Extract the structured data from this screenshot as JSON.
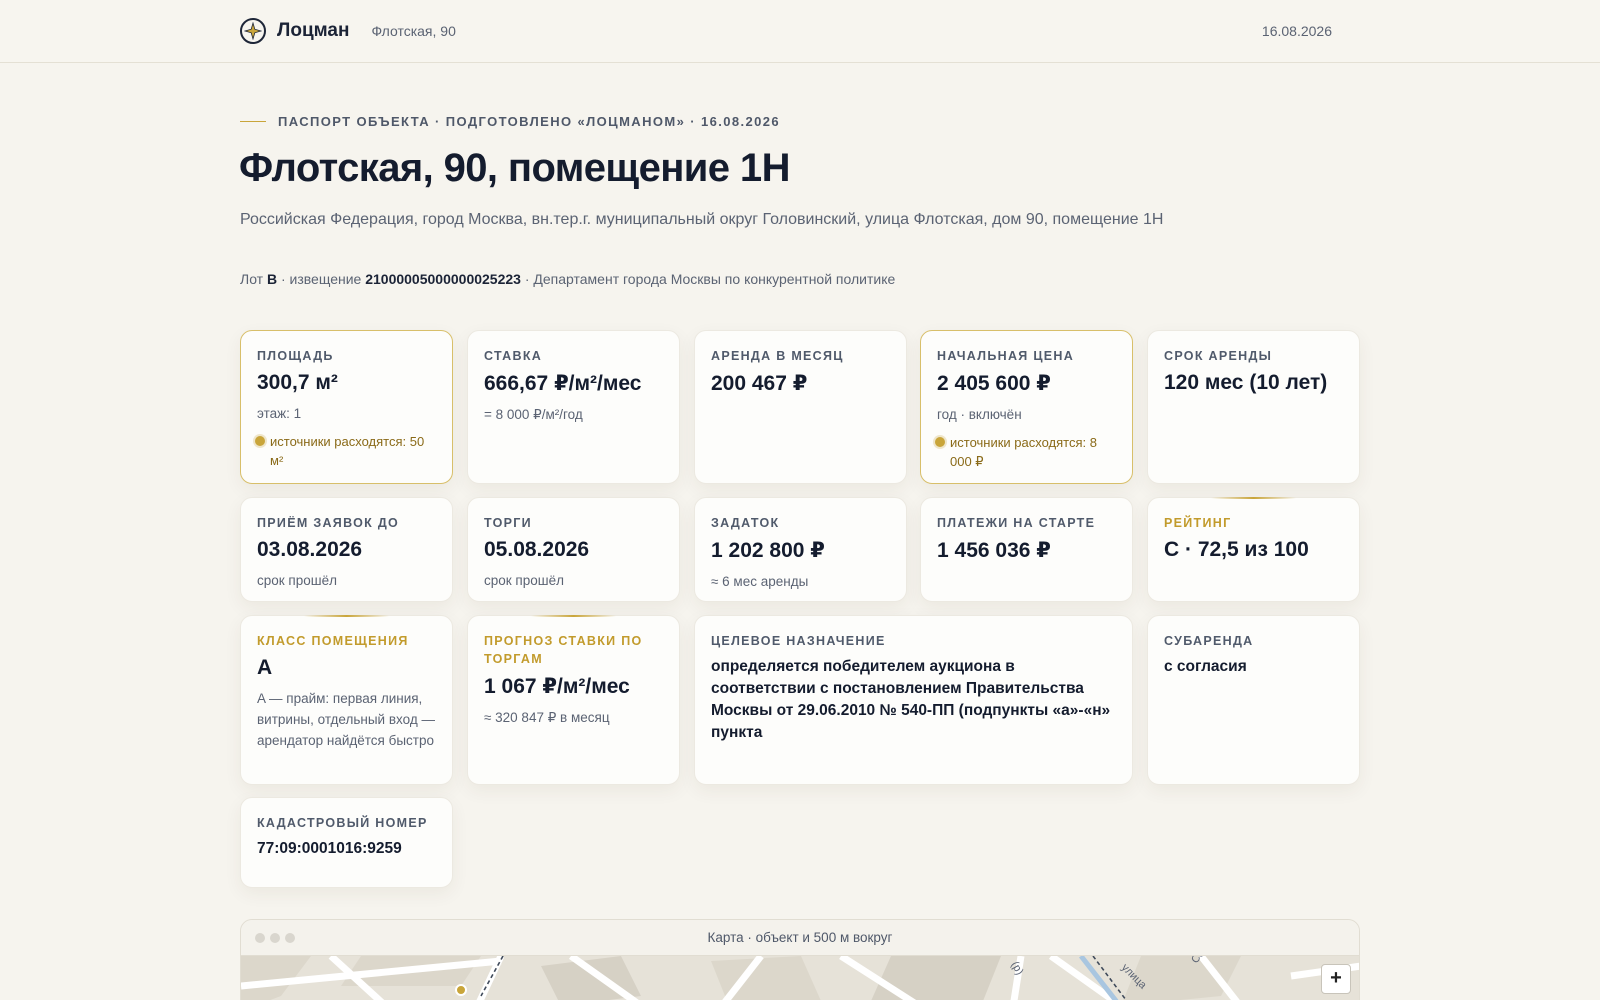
{
  "header": {
    "brand": "Лоцман",
    "address": "Флотская, 90",
    "date": "16.08.2026"
  },
  "passport": {
    "eyebrow": "ПАСПОРТ ОБЪЕКТА · ПОДГОТОВЛЕНО «ЛОЦМАНОМ» · 16.08.2026",
    "title": "Флотская, 90, помещение 1Н",
    "full_address": "Российская Федерация, город Москва, вн.тер.г. муниципальный округ Головинский, улица Флотская, дом 90, помещение 1Н",
    "lot_prefix": "Лот ",
    "lot": "В",
    "notice_prefix": " · извещение ",
    "notice": "21000005000000025223",
    "organizer": " · Департамент города Москвы по конкурентной политике"
  },
  "cards": {
    "area": {
      "label": "ПЛОЩАДЬ",
      "value": "300,7 м²",
      "sub": "этаж: 1",
      "warn": "источники расходятся: 50 м²"
    },
    "rate": {
      "label": "СТАВКА",
      "value": "666,67 ₽/м²/мес",
      "sub": "= 8 000 ₽/м²/год"
    },
    "monthly": {
      "label": "АРЕНДА В МЕСЯЦ",
      "value": "200 467 ₽"
    },
    "start_price": {
      "label": "НАЧАЛЬНАЯ ЦЕНА",
      "value": "2 405 600 ₽",
      "sub": "год · включён",
      "warn": "источники расходятся: 8 000 ₽"
    },
    "term": {
      "label": "СРОК АРЕНДЫ",
      "value": "120 мес (10 лет)"
    },
    "apps_until": {
      "label": "ПРИЁМ ЗАЯВОК ДО",
      "value": "03.08.2026",
      "sub": "срок прошёл"
    },
    "auction": {
      "label": "ТОРГИ",
      "value": "05.08.2026",
      "sub": "срок прошёл"
    },
    "deposit": {
      "label": "ЗАДАТОК",
      "value": "1 202 800 ₽",
      "sub": "≈ 6 мес аренды"
    },
    "start_payments": {
      "label": "ПЛАТЕЖИ НА СТАРТЕ",
      "value": "1 456 036 ₽"
    },
    "rating": {
      "label": "РЕЙТИНГ",
      "value": "C · 72,5 из 100"
    },
    "class": {
      "label": "КЛАСС ПОМЕЩЕНИЯ",
      "value": "A",
      "sub": "A — прайм: первая линия, витрины, отдельный вход — арендатор найдётся быстро"
    },
    "forecast": {
      "label": "ПРОГНОЗ СТАВКИ ПО ТОРГАМ",
      "value": "1 067 ₽/м²/мес",
      "sub": "≈ 320 847 ₽ в месяц"
    },
    "purpose": {
      "label": "ЦЕЛЕВОЕ НАЗНАЧЕНИЕ",
      "value": "определяется победителем аукциона в соответствии с постановлением Правительства Москвы от 29.06.2010 № 540-ПП (подпункты «а»-«н» пункта"
    },
    "sublease": {
      "label": "СУБАРЕНДА",
      "value": "с согласия"
    },
    "cadastral": {
      "label": "КАДАСТРОВЫЙ НОМЕР",
      "value": "77:09:0001016:9259"
    }
  },
  "map": {
    "title": "Карта · объект и 500 м вокруг",
    "zoom_in": "+",
    "street_labels": [
      "улица",
      "(р)",
      "Со"
    ]
  },
  "colors": {
    "accent": "#c9a53a",
    "background": "#f6f4ee",
    "ink": "#141c2e"
  },
  "icons": {
    "logo": "compass-icon",
    "warning": "warning-dot-icon"
  }
}
